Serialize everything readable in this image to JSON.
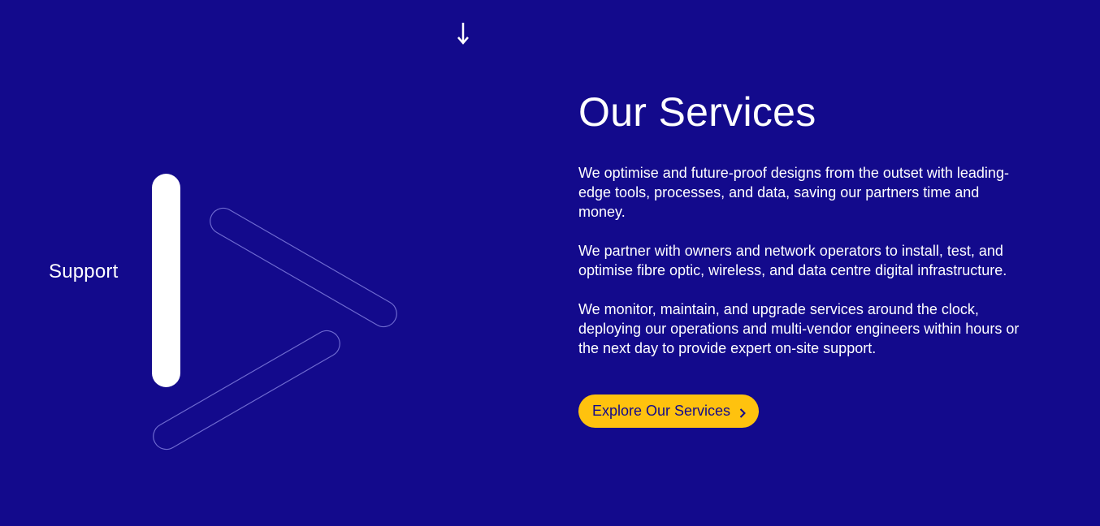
{
  "scroll_hint": {
    "icon": "arrow-down-icon"
  },
  "graphic": {
    "label": "Support"
  },
  "services": {
    "title": "Our Services",
    "paragraphs": [
      "We optimise and future-proof designs from the outset with leading-edge tools, processes, and data, saving our partners time and money.",
      "We partner with owners and network operators to install, test, and optimise fibre optic, wireless, and data centre digital infrastructure.",
      "We monitor, maintain, and upgrade services around the clock, deploying our operations and multi-vendor engineers within hours or the next day to provide expert on-site support."
    ],
    "cta_label": "Explore Our Services",
    "cta_icon": "chevron-right-icon"
  },
  "colors": {
    "background": "#130a8c",
    "accent": "#ffc20e",
    "text": "#ffffff"
  }
}
